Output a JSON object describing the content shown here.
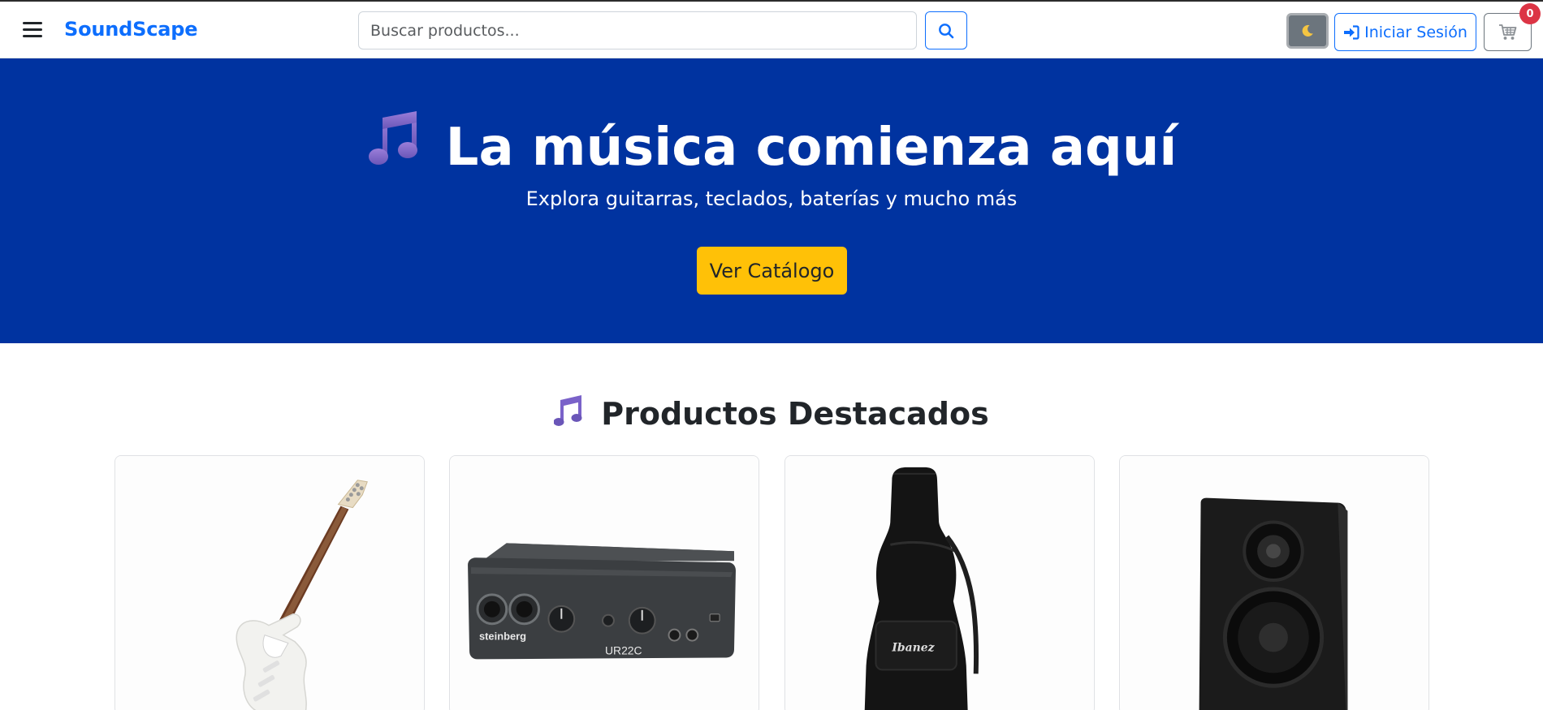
{
  "navbar": {
    "menu_icon": "hamburger-icon",
    "brand": "SoundScape",
    "search_placeholder": "Buscar productos...",
    "search_icon": "search-icon",
    "theme_icon": "moon-icon",
    "login_label": "Iniciar Sesión",
    "login_icon": "sign-in-icon",
    "cart_icon": "cart-icon",
    "cart_count": "0"
  },
  "hero": {
    "title": "La música comienza aquí",
    "title_icon": "music-note-icon",
    "subtitle": "Explora guitarras, teclados, baterías y mucho más",
    "cta_label": "Ver Catálogo"
  },
  "featured": {
    "title": "Productos Destacados",
    "title_icon": "musical-notes-icon",
    "products": [
      {
        "image": "electric-guitar-image"
      },
      {
        "image": "audio-interface-image",
        "brand_text": "steinberg",
        "model_text": "UR22C"
      },
      {
        "image": "guitar-gig-bag-image",
        "brand_text": "Ibanez"
      },
      {
        "image": "studio-monitor-speaker-image"
      }
    ]
  },
  "colors": {
    "primary": "#0d6efd",
    "hero_bg": "#0033a0",
    "cta": "#ffc107",
    "badge": "#dc3545"
  }
}
